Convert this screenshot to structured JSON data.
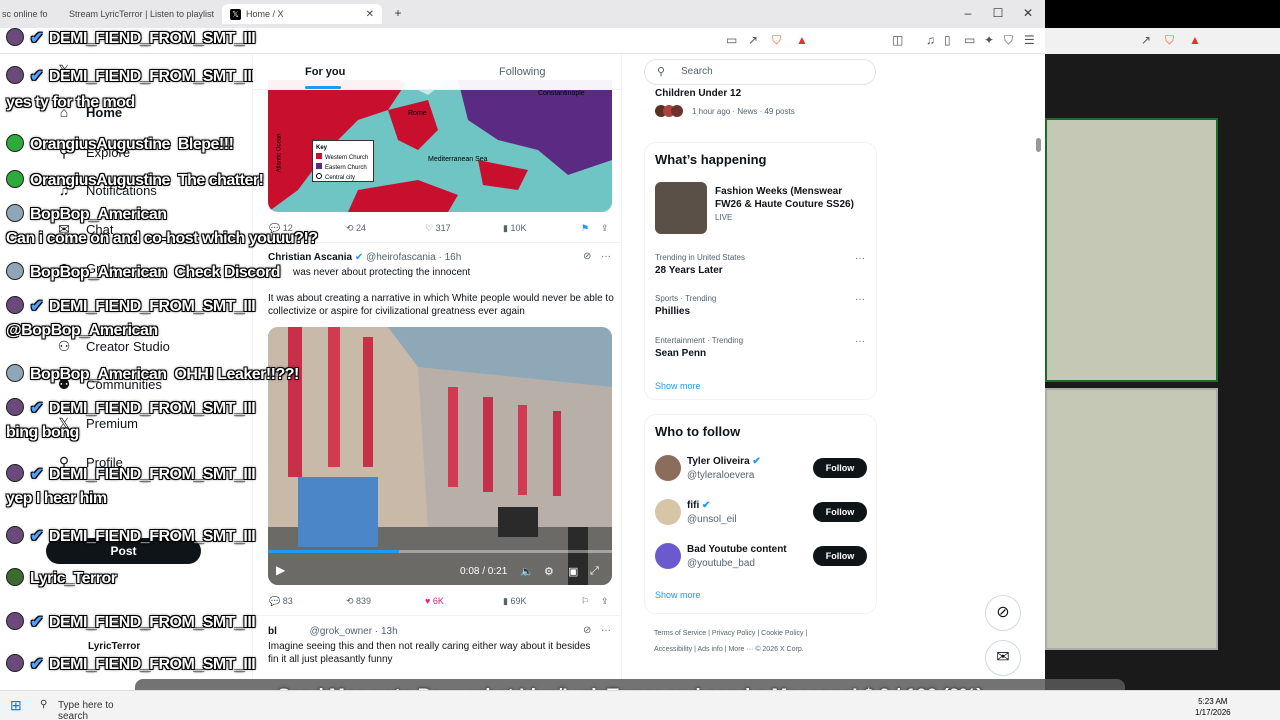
{
  "tabs": [
    {
      "label": "sc online fo"
    },
    {
      "label": "Stream LyricTerror | Listen to playlist"
    },
    {
      "label": "Home / X"
    }
  ],
  "x": {
    "nav": [
      "Home",
      "Explore",
      "Notifications",
      "Chat",
      "Grok",
      "Creator Studio",
      "Communities",
      "Premium",
      "Profile"
    ],
    "post_button": "Post",
    "account_name": "LyricTerror",
    "timeline_tabs": [
      "For you",
      "Following"
    ],
    "map": {
      "labels": [
        "Constantinople",
        "Rome",
        "Mediterranean Sea",
        "Atlantic Ocean"
      ],
      "key_title": "Key",
      "key_items": [
        {
          "label": "Western Church",
          "color": "#c8102e"
        },
        {
          "label": "Eastern Church",
          "color": "#5b2a82"
        },
        {
          "label": "Central city",
          "color": "#ffffff"
        }
      ]
    },
    "tweet1_stats": {
      "replies": "12",
      "reposts": "24",
      "likes": "317",
      "views": "10K"
    },
    "tweet2": {
      "author": "Christian Ascania",
      "handle": "@heirofascania",
      "time": "16h",
      "line1": "was never about protecting the innocent",
      "line2": "It was about creating a narrative in which White people would never be able to collectivize or aspire for civilizational greatness ever again",
      "video_time": "0:08 / 0:21",
      "stats": {
        "replies": "83",
        "reposts": "839",
        "likes": "6K",
        "views": "69K"
      }
    },
    "tweet3": {
      "author": "bl",
      "handle": "@grok_owner",
      "time": "13h",
      "line1": "Imagine seeing this and then not really caring either way about it besides",
      "line2": "fin   it all just pleasantly funny"
    },
    "search_placeholder": "Search",
    "news_item": {
      "title": "Children Under 12",
      "meta": "1 hour ago · News · 49 posts"
    },
    "whats_happening": {
      "title": "What’s happening",
      "featured": {
        "title": "Fashion Weeks (Menswear FW26 & Haute Couture SS26)",
        "status": "LIVE"
      },
      "trends": [
        {
          "context": "Trending in United States",
          "name": "28 Years Later"
        },
        {
          "context": "Sports · Trending",
          "name": "Phillies"
        },
        {
          "context": "Entertainment · Trending",
          "name": "Sean Penn"
        }
      ],
      "show_more": "Show more"
    },
    "who_to_follow": {
      "title": "Who to follow",
      "accounts": [
        {
          "name": "Tyler Oliveira",
          "handle": "@tyleraloevera",
          "color": "#8a6d5a"
        },
        {
          "name": "fifi",
          "handle": "@unsol_eil",
          "color": "#d8c4a6"
        },
        {
          "name": "Bad Youtube content",
          "handle": "@youtube_bad",
          "color": "#6a5acd"
        }
      ],
      "follow_label": "Follow",
      "show_more": "Show more"
    },
    "footer": [
      "Terms of Service",
      "Privacy Policy",
      "Cookie Policy",
      "Accessibility",
      "Ads info",
      "More ···",
      "© 2026 X Corp."
    ]
  },
  "chat": [
    {
      "user": "DEMI_FIEND_FROM_SMT_III",
      "message": "",
      "badge": "#6a4a7a",
      "verified": true
    },
    {
      "user": "DEMI_FIEND_FROM_SMT_III",
      "message": "",
      "badge": "#6a4a7a",
      "verified": true
    },
    {
      "user": "",
      "message": "yes ty for the mod",
      "badge": "",
      "verified": false
    },
    {
      "user": "OrangiusAugustine",
      "message": "Blepe!!!",
      "badge": "#2eaa3c",
      "verified": false
    },
    {
      "user": "OrangiusAugustine",
      "message": "The chatter!",
      "badge": "#2eaa3c",
      "verified": false
    },
    {
      "user": "BopBop_American",
      "message": "",
      "badge": "#8fa6b8",
      "verified": false
    },
    {
      "user": "",
      "message": "Can i come on and co-host which youuu?!?",
      "badge": "",
      "verified": false
    },
    {
      "user": "BopBop_American",
      "message": "Check Discord",
      "badge": "#8fa6b8",
      "verified": false
    },
    {
      "user": "DEMI_FIEND_FROM_SMT_III",
      "message": "",
      "badge": "#6a4a7a",
      "verified": true
    },
    {
      "user": "",
      "message": "@BopBop_American",
      "badge": "",
      "verified": false
    },
    {
      "user": "BopBop_American",
      "message": "OHH! Leaker!!??!",
      "badge": "#8fa6b8",
      "verified": false
    },
    {
      "user": "DEMI_FIEND_FROM_SMT_III",
      "message": "",
      "badge": "#6a4a7a",
      "verified": true
    },
    {
      "user": "",
      "message": "bing bong",
      "badge": "",
      "verified": false
    },
    {
      "user": "DEMI_FIEND_FROM_SMT_III",
      "message": "",
      "badge": "#6a4a7a",
      "verified": true
    },
    {
      "user": "",
      "message": "yep I hear him",
      "badge": "",
      "verified": false
    },
    {
      "user": "DEMI_FIEND_FROM_SMT_III",
      "message": "",
      "badge": "#6a4a7a",
      "verified": true
    },
    {
      "user": "Lyric_Terror",
      "message": "",
      "badge": "#3c6b2e",
      "verified": false
    },
    {
      "user": "DEMI_FIEND_FROM_SMT_III",
      "message": "",
      "badge": "#6a4a7a",
      "verified": true
    },
    {
      "user": "DEMI_FIEND_FROM_SMT_III",
      "message": "",
      "badge": "#6a4a7a",
      "verified": true
    }
  ],
  "donation_banner": "Send Money to Powerchat.Live/LyricTerror and send a Message! $ 0 / 100 (0%)",
  "taskbar": {
    "search_placeholder": "Type here to search",
    "time": "5:23 AM",
    "date": "1/17/2026"
  },
  "colors": {
    "accent": "#1d9bf0",
    "like": "#f91880",
    "western_church": "#c8102e",
    "eastern_church": "#5b2a82"
  }
}
